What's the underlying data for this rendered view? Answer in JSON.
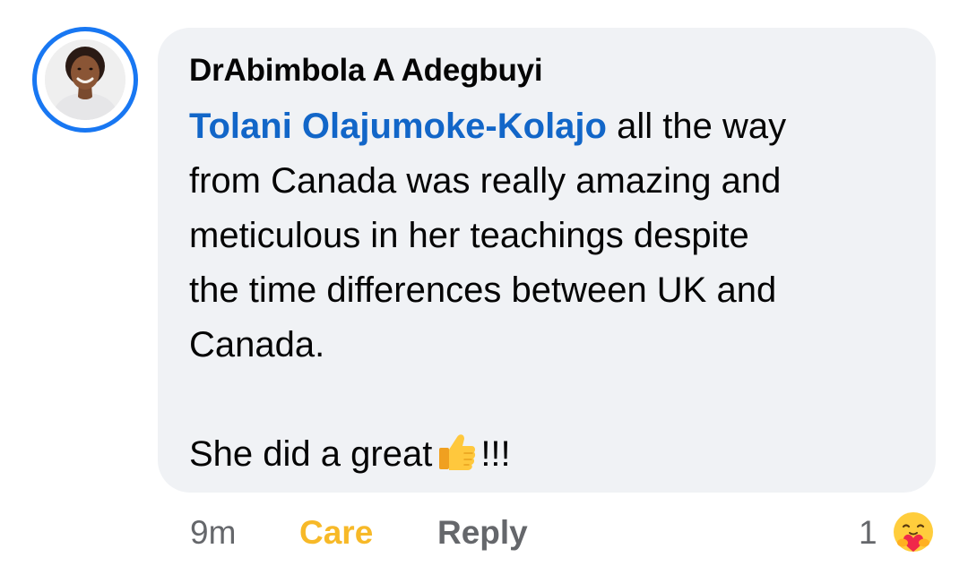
{
  "author": {
    "name": "DrAbimbola A Adegbuyi"
  },
  "comment": {
    "mention": "Tolani Olajumoke-Kolajo",
    "line1_rest": " all the way",
    "line2": "from Canada was really amazing and",
    "line3": "meticulous in her teachings despite",
    "line4": "the time differences between UK and",
    "line5": "Canada.",
    "line7_text": "She did a great",
    "line7_suffix": "!!!"
  },
  "actions": {
    "time": "9m",
    "reaction_label": "Care",
    "reply_label": "Reply",
    "reaction_count": "1"
  },
  "icons": {
    "avatar": "profile-photo",
    "inline_emoji": "thumbs-up-emoji",
    "reaction_icon": "care-emoji"
  },
  "colors": {
    "accent": "#1877f2",
    "mention": "#1266c8",
    "bubble": "#f0f2f5",
    "care": "#f7b928",
    "muted": "#65676b"
  }
}
